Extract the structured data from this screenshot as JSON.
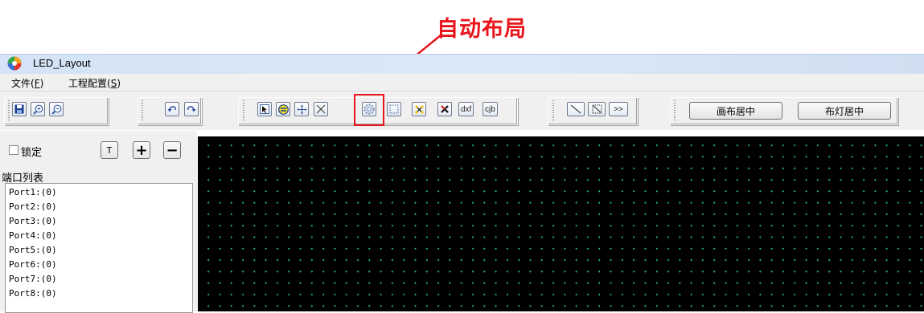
{
  "annotation": {
    "text": "自动布局",
    "color": "#e8151b"
  },
  "window": {
    "title": "LED_Layout",
    "icon": "app-swirl-icon"
  },
  "menu": {
    "items": [
      {
        "label": "文件(",
        "key": "F",
        "suffix": ")"
      },
      {
        "label": "工程配置(",
        "key": "S",
        "suffix": ")"
      }
    ]
  },
  "toolbar": {
    "file_group": [
      "save-icon",
      "zoom-in-icon",
      "zoom-out-icon"
    ],
    "edit_group": [
      "undo-icon",
      "redo-icon"
    ],
    "tool_group": [
      "select-arrow-icon",
      "rotate-icon",
      "move-cross-icon",
      "delete-line-icon",
      "auto-layout-gear-icon",
      "rect-select-icon",
      "scatter-icon",
      "remove-x-icon"
    ],
    "dxf_label": "dxf",
    "cjb_label": "cjb",
    "line_group": [
      "line-icon",
      "diagonal-box-icon"
    ],
    "more_label": ">>",
    "center_canvas_label": "画布居中",
    "center_lights_label": "布灯居中"
  },
  "left_panel": {
    "lock_label": "锁定",
    "lock_checked": false,
    "t_button_label": "T",
    "plus_button_label": "+",
    "minus_button_label": "−",
    "port_list_title": "端口列表",
    "ports": [
      "Port1:(0)",
      "Port2:(0)",
      "Port3:(0)",
      "Port4:(0)",
      "Port5:(0)",
      "Port6:(0)",
      "Port7:(0)",
      "Port8:(0)"
    ]
  },
  "canvas": {
    "background": "#000000",
    "grid_dot_color": "#20c08a"
  }
}
